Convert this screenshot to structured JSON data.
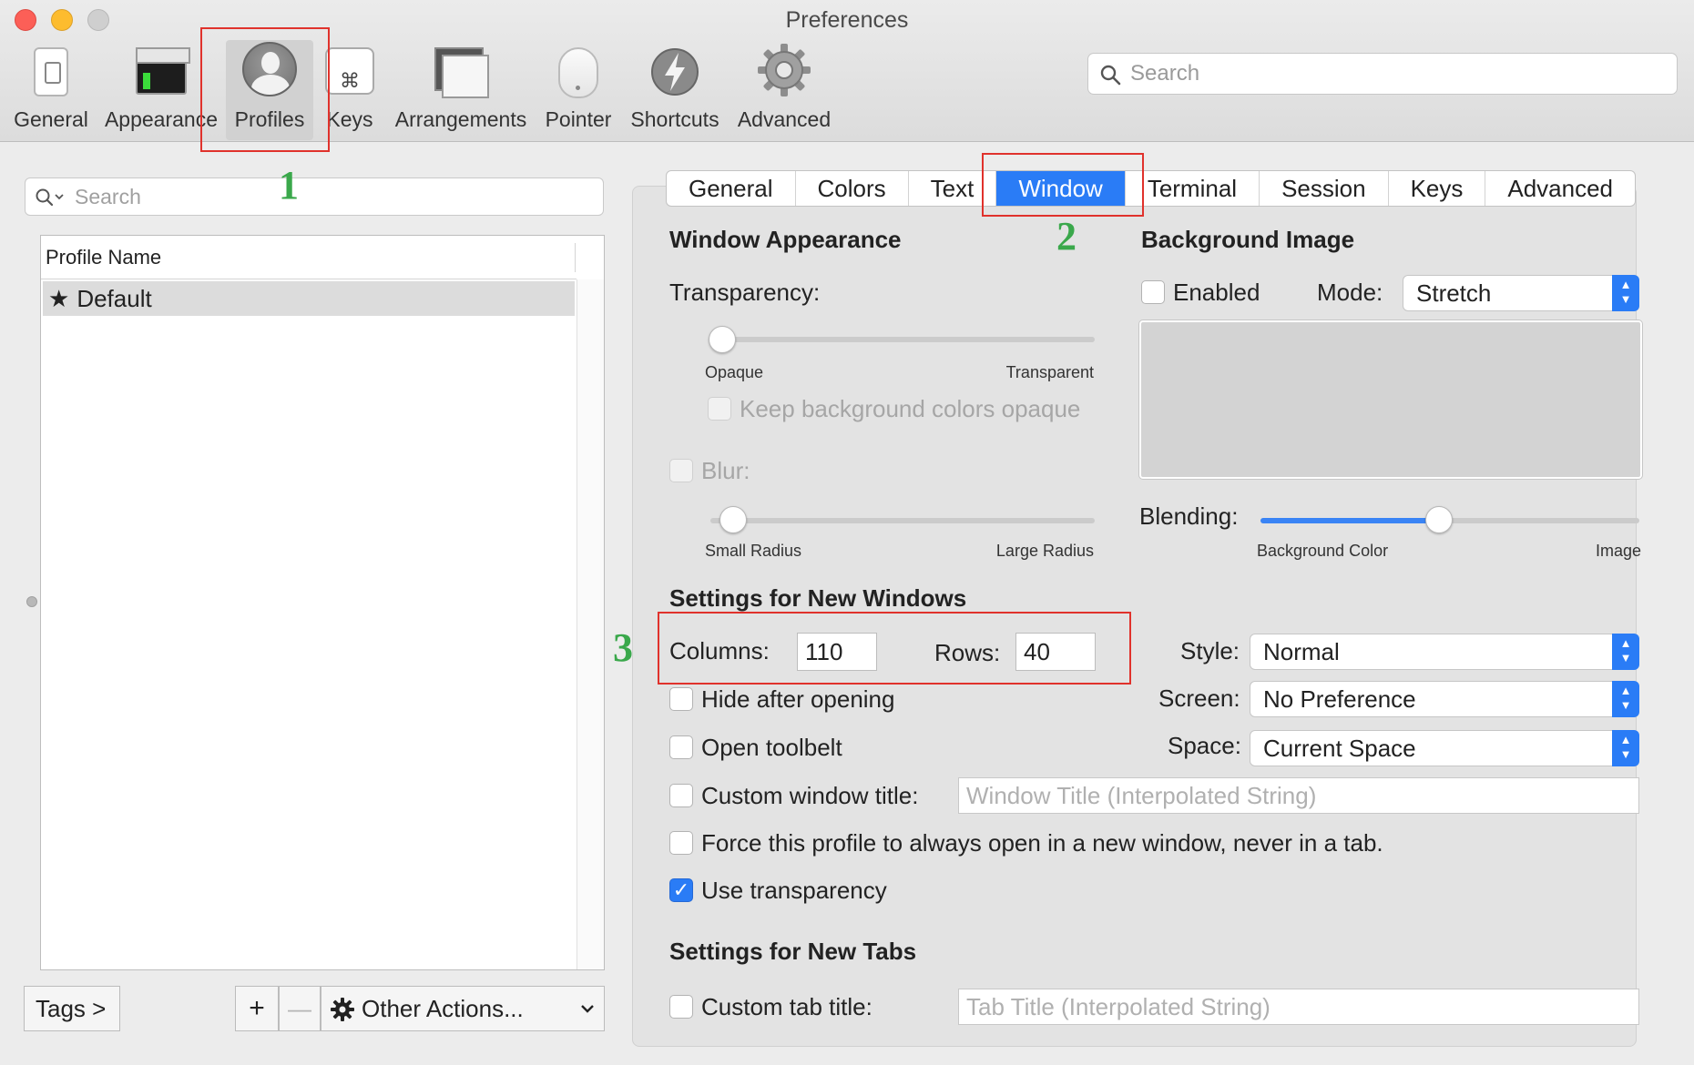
{
  "window": {
    "title": "Preferences"
  },
  "toolbar": {
    "items": [
      {
        "label": "General",
        "icon": "general-icon"
      },
      {
        "label": "Appearance",
        "icon": "appearance-icon"
      },
      {
        "label": "Profiles",
        "icon": "profile-icon",
        "selected": true
      },
      {
        "label": "Keys",
        "icon": "keys-icon"
      },
      {
        "label": "Arrangements",
        "icon": "arrangements-icon"
      },
      {
        "label": "Pointer",
        "icon": "pointer-icon"
      },
      {
        "label": "Shortcuts",
        "icon": "shortcuts-icon"
      },
      {
        "label": "Advanced",
        "icon": "gear-icon"
      }
    ],
    "search_placeholder": "Search"
  },
  "profiles_pane": {
    "search_placeholder": "Search",
    "column_header": "Profile Name",
    "profiles": [
      {
        "name": "Default",
        "is_default": true,
        "selected": true
      }
    ],
    "tags_button": "Tags >",
    "add_button": "+",
    "remove_button": "—",
    "other_actions_button": "Other Actions..."
  },
  "tabs": [
    {
      "label": "General"
    },
    {
      "label": "Colors"
    },
    {
      "label": "Text"
    },
    {
      "label": "Window",
      "active": true
    },
    {
      "label": "Terminal"
    },
    {
      "label": "Session"
    },
    {
      "label": "Keys"
    },
    {
      "label": "Advanced"
    }
  ],
  "window_appearance": {
    "heading": "Window Appearance",
    "transparency_label": "Transparency:",
    "transparency_min_label": "Opaque",
    "transparency_max_label": "Transparent",
    "transparency_value": 0.0,
    "keep_bg_opaque_label": "Keep background colors opaque",
    "keep_bg_opaque_checked": false,
    "blur_label": "Blur:",
    "blur_checked": false,
    "blur_min_label": "Small Radius",
    "blur_max_label": "Large Radius",
    "blur_value": 0.06
  },
  "background_image": {
    "heading": "Background Image",
    "enabled_label": "Enabled",
    "enabled_checked": false,
    "mode_label": "Mode:",
    "mode_value": "Stretch",
    "blending_label": "Blending:",
    "blending_min_label": "Background Color",
    "blending_max_label": "Image",
    "blending_value": 0.47
  },
  "new_windows": {
    "heading": "Settings for New Windows",
    "columns_label": "Columns:",
    "columns_value": "110",
    "rows_label": "Rows:",
    "rows_value": "40",
    "style_label": "Style:",
    "style_value": "Normal",
    "screen_label": "Screen:",
    "screen_value": "No Preference",
    "space_label": "Space:",
    "space_value": "Current Space",
    "hide_after_opening_label": "Hide after opening",
    "open_toolbelt_label": "Open toolbelt",
    "custom_window_title_label": "Custom window title:",
    "custom_window_title_placeholder": "Window Title (Interpolated String)",
    "force_new_window_label": "Force this profile to always open in a new window, never in a tab.",
    "use_transparency_label": "Use transparency",
    "use_transparency_checked": true
  },
  "new_tabs": {
    "heading": "Settings for New Tabs",
    "custom_tab_title_label": "Custom tab title:",
    "custom_tab_title_placeholder": "Tab Title (Interpolated String)"
  },
  "annotations": {
    "step1": "1",
    "step2": "2",
    "step3": "3"
  },
  "colors": {
    "accent": "#2a7cf6",
    "annotation_box": "#e0322c",
    "annotation_number": "#3aa84b"
  }
}
